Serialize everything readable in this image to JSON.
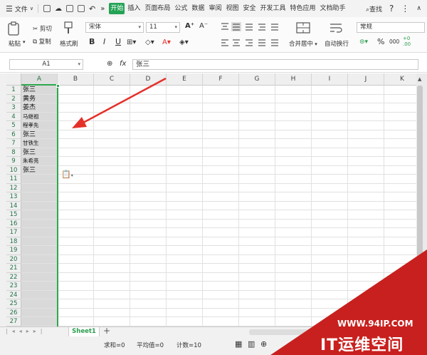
{
  "menu": {
    "file": "文件",
    "tabs": [
      "开始",
      "插入",
      "页面布局",
      "公式",
      "数据",
      "审阅",
      "视图",
      "安全",
      "开发工具",
      "特色应用",
      "文档助手"
    ],
    "active_tab": "开始",
    "search": "查找",
    "help": "?",
    "more": "⋮"
  },
  "ribbon": {
    "paste": "粘贴",
    "cut": "剪切",
    "copy": "复制",
    "format_painter": "格式刷",
    "font_name": "宋体",
    "font_size": "11",
    "bold": "B",
    "italic": "I",
    "underline": "U",
    "increase_font": "A⁺",
    "decrease_font": "A⁻",
    "merge_center": "合并居中",
    "wrap_text": "自动换行",
    "number_format": "常规",
    "percent": "%",
    "thousands": "000"
  },
  "formula_bar": {
    "cell_ref": "A1",
    "fx": "fx",
    "value": "张三"
  },
  "sheet": {
    "columns": [
      "A",
      "B",
      "C",
      "D",
      "E",
      "F",
      "G",
      "H",
      "I",
      "J",
      "K"
    ],
    "rows": [
      "1",
      "2",
      "3",
      "4",
      "5",
      "6",
      "7",
      "8",
      "9",
      "10",
      "11",
      "12",
      "13",
      "14",
      "15",
      "16",
      "17",
      "18",
      "19",
      "20",
      "21",
      "22",
      "23",
      "24",
      "25",
      "26",
      "27"
    ],
    "column_a_values": [
      "张三",
      "黄务",
      "姜杰",
      "马继祖",
      "程孝先",
      "张三",
      "甘铁生",
      "张三",
      "朱希亮",
      "张三"
    ],
    "small_rows": [
      3,
      4,
      6,
      8
    ]
  },
  "sheet_tabs": {
    "active": "Sheet1",
    "add": "+"
  },
  "status": {
    "sum": "求和=0",
    "average": "平均值=0",
    "count": "计数=10"
  },
  "watermark": {
    "url": "WWW.94IP.COM",
    "text": "IT运维空间"
  },
  "colors": {
    "accent_green": "#24a355",
    "selection_green": "#2ca84f",
    "arrow_red": "#e5302a",
    "watermark_red": "#c8201e"
  }
}
